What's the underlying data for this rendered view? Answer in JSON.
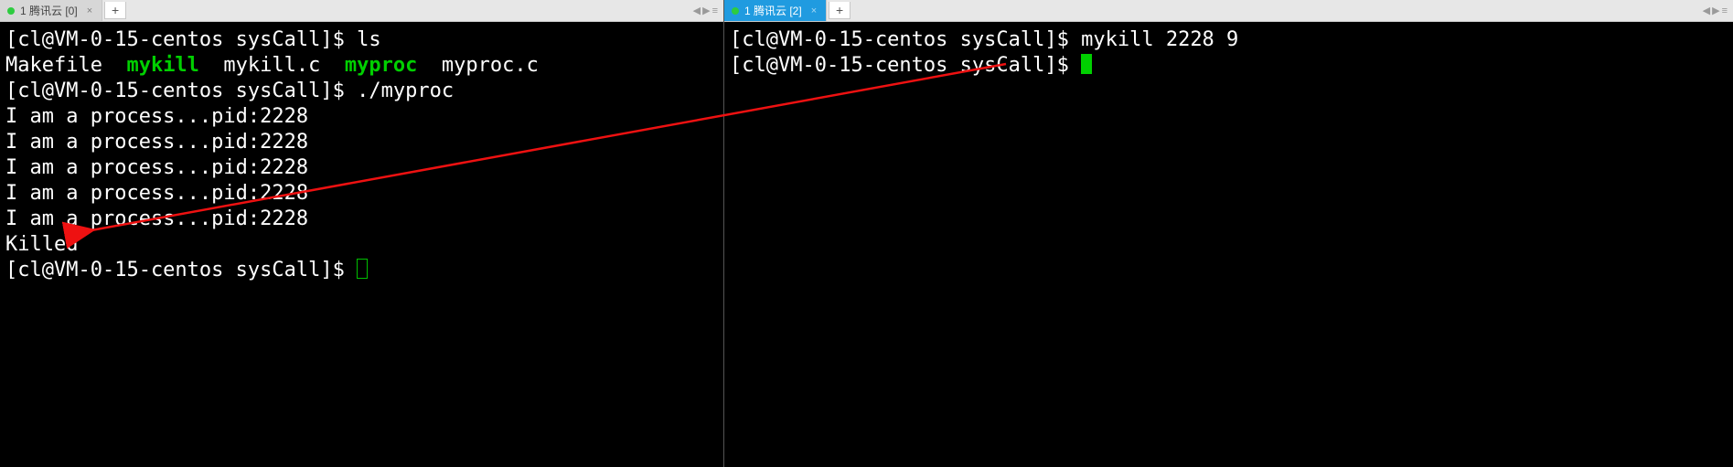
{
  "tabs": {
    "left": {
      "title": "1 腾讯云 [0]"
    },
    "right": {
      "title": "1 腾讯云 [2]"
    }
  },
  "left_term": {
    "prompt": "[cl@VM-0-15-centos sysCall]$ ",
    "cmd_ls": "ls",
    "ls_items": [
      "Makefile",
      "mykill",
      "mykill.c",
      "myproc",
      "myproc.c"
    ],
    "cmd_run": "./myproc",
    "proc_line": "I am a process...pid:2228",
    "proc_count": 5,
    "killed": "Killed"
  },
  "right_term": {
    "prompt": "[cl@VM-0-15-centos sysCall]$ ",
    "cmd": "mykill 2228 9"
  },
  "glyphs": {
    "left_arrow": "◀",
    "right_arrow": "▶",
    "menu": "≡",
    "close": "×",
    "plus": "+"
  }
}
